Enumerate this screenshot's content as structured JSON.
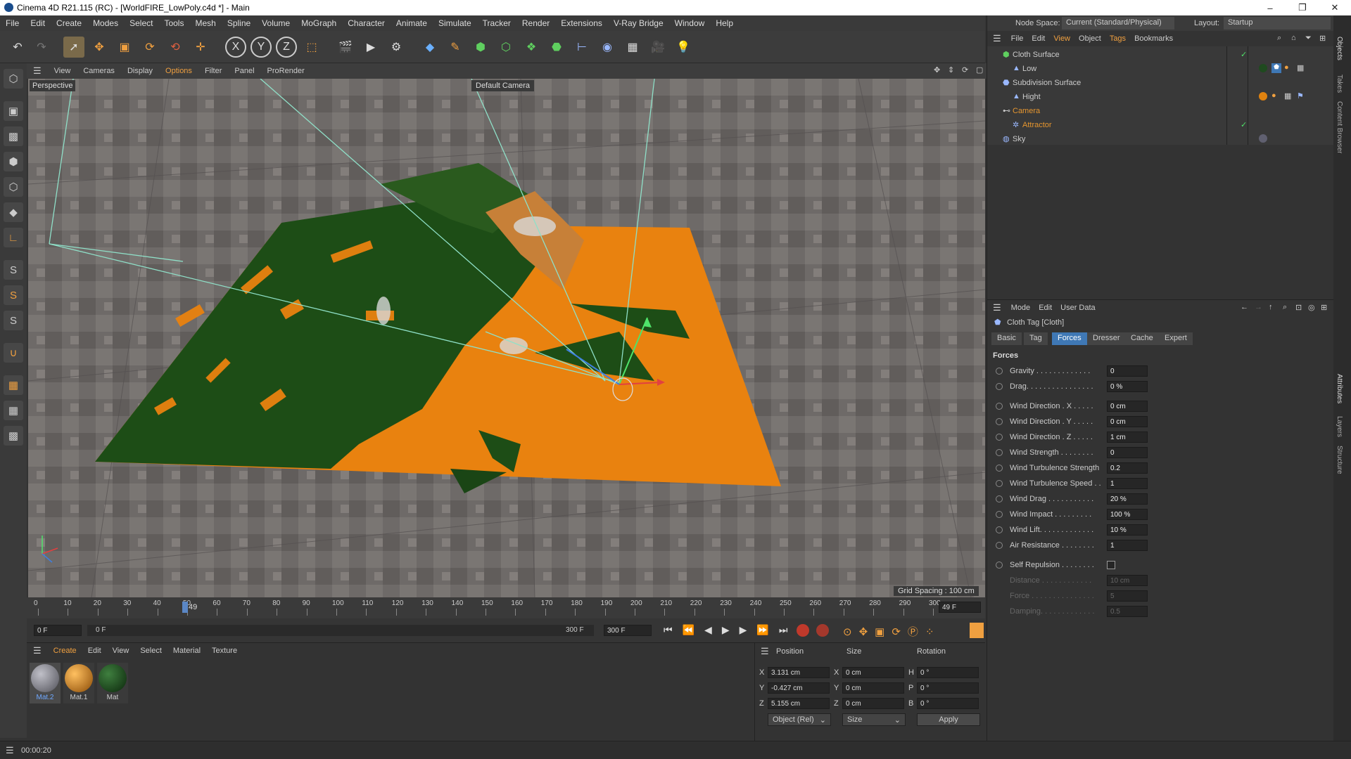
{
  "window": {
    "title": "Cinema 4D R21.115 (RC) - [WorldFIRE_LowPoly.c4d *] - Main",
    "minimize_label": "–",
    "maximize_label": "❐",
    "close_label": "✕"
  },
  "menu": [
    "File",
    "Edit",
    "Create",
    "Modes",
    "Select",
    "Tools",
    "Mesh",
    "Spline",
    "Volume",
    "MoGraph",
    "Character",
    "Animate",
    "Simulate",
    "Tracker",
    "Render",
    "Extensions",
    "V-Ray Bridge",
    "Window",
    "Help"
  ],
  "nodespace": {
    "label": "Node Space:",
    "value": "Current (Standard/Physical)"
  },
  "layout": {
    "label": "Layout:",
    "value": "Startup"
  },
  "viewport": {
    "menu": [
      "View",
      "Cameras",
      "Display",
      "Options",
      "Filter",
      "Panel",
      "ProRender"
    ],
    "name": "Perspective",
    "camera": "Default Camera",
    "grid_spacing": "Grid Spacing : 100 cm"
  },
  "timeline": {
    "ticks": [
      "0",
      "10",
      "20",
      "30",
      "40",
      "50",
      "60",
      "70",
      "80",
      "90",
      "100",
      "110",
      "120",
      "130",
      "140",
      "150",
      "160",
      "170",
      "180",
      "190",
      "200",
      "210",
      "220",
      "230",
      "240",
      "250",
      "260",
      "270",
      "280",
      "290",
      "300"
    ],
    "current_frame_marker": "49",
    "frame_readout": "49 F"
  },
  "playback": {
    "start": "0 F",
    "min": "0 F",
    "max": "300 F",
    "end": "300 F"
  },
  "material_manager": {
    "menu": [
      "Create",
      "Edit",
      "View",
      "Select",
      "Material",
      "Texture"
    ],
    "materials": [
      {
        "name": "Mat.2",
        "color": "#7a7a80"
      },
      {
        "name": "Mat.1",
        "color": "#e0820f"
      },
      {
        "name": "Mat",
        "color": "#1f4a1f"
      }
    ]
  },
  "coordinates": {
    "headers": [
      "Position",
      "Size",
      "Rotation"
    ],
    "rows": [
      {
        "axis": "X",
        "pos": "3.131 cm",
        "saxis": "X",
        "size": "0 cm",
        "raxis": "H",
        "rot": "0 °"
      },
      {
        "axis": "Y",
        "pos": "-0.427 cm",
        "saxis": "Y",
        "size": "0 cm",
        "raxis": "P",
        "rot": "0 °"
      },
      {
        "axis": "Z",
        "pos": "5.155 cm",
        "saxis": "Z",
        "size": "0 cm",
        "raxis": "B",
        "rot": "0 °"
      }
    ],
    "mode": "Object (Rel)",
    "size_mode": "Size",
    "apply": "Apply"
  },
  "status": {
    "time": "00:00:20"
  },
  "object_manager": {
    "menu": [
      "File",
      "Edit",
      "View",
      "Object",
      "Tags",
      "Bookmarks"
    ],
    "objects": [
      {
        "name": "Cloth Surface",
        "indent": 0,
        "color": "#ccc"
      },
      {
        "name": "Low",
        "indent": 1,
        "color": "#ccc"
      },
      {
        "name": "Subdivision Surface",
        "indent": 0,
        "color": "#ccc"
      },
      {
        "name": "Hight",
        "indent": 1,
        "color": "#ccc"
      },
      {
        "name": "Camera",
        "indent": 0,
        "color": "#e6962f"
      },
      {
        "name": "Attractor",
        "indent": 1,
        "color": "#e6962f"
      },
      {
        "name": "Sky",
        "indent": 0,
        "color": "#ccc"
      }
    ]
  },
  "side_tabs": [
    "Objects",
    "Takes",
    "Content Browser",
    "Attributes",
    "Layers",
    "Structure"
  ],
  "attributes": {
    "menu": [
      "Mode",
      "Edit",
      "User Data"
    ],
    "title": "Cloth Tag [Cloth]",
    "tabs": [
      "Basic",
      "Tag",
      "Forces",
      "Dresser",
      "Cache",
      "Expert"
    ],
    "active_tab": "Forces",
    "section": "Forces",
    "rows": [
      {
        "label": "Gravity . . . . . . . . . . . . .",
        "value": "0"
      },
      {
        "label": "Drag. . . . . . . . . . . . . . . .",
        "value": "0 %"
      },
      {
        "label": "Wind Direction . X . . . . .",
        "value": "0 cm"
      },
      {
        "label": "Wind Direction . Y . . . . .",
        "value": "0 cm"
      },
      {
        "label": "Wind Direction . Z . . . . .",
        "value": "1 cm"
      },
      {
        "label": "Wind Strength . . . . . . . .",
        "value": "0"
      },
      {
        "label": "Wind Turbulence Strength",
        "value": "0.2"
      },
      {
        "label": "Wind Turbulence Speed . .",
        "value": "1"
      },
      {
        "label": "Wind Drag . . . . . . . . . . .",
        "value": "20 %"
      },
      {
        "label": "Wind Impact . . . . . . . . .",
        "value": "100 %"
      },
      {
        "label": "Wind Lift. . . . . . . . . . . . .",
        "value": "10 %"
      },
      {
        "label": "Air Resistance . . . . . . . .",
        "value": "1"
      }
    ],
    "self_repulsion": "Self Repulsion . . . . . . . .",
    "dim_rows": [
      {
        "label": "Distance . . . . . . . . . . . .",
        "value": "10 cm"
      },
      {
        "label": "Force . . . . . . . . . . . . . . .",
        "value": "5"
      },
      {
        "label": "Damping. . . . . . . . . . . . .",
        "value": "0.5"
      }
    ]
  }
}
